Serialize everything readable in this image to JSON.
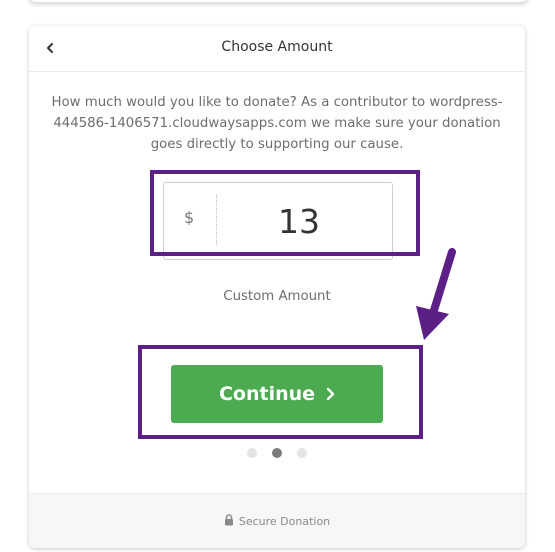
{
  "header": {
    "title": "Choose Amount",
    "back_icon": "chevron-left-icon"
  },
  "main": {
    "description": "How much would you like to donate? As a contributor to wordpress-444586-1406571.cloudwaysapps.com we make sure your donation goes directly to supporting our cause.",
    "currency_symbol": "$",
    "amount_value": "13",
    "custom_amount_label": "Custom Amount",
    "continue_label": "Continue",
    "continue_icon": "chevron-right-icon",
    "steps": {
      "total": 3,
      "current": 2
    }
  },
  "footer": {
    "label": "Secure Donation",
    "icon": "lock-icon"
  },
  "colors": {
    "accent_green": "#4caa50",
    "annotation_purple": "#5b1f86",
    "active_dot": "#7a7a7a"
  }
}
